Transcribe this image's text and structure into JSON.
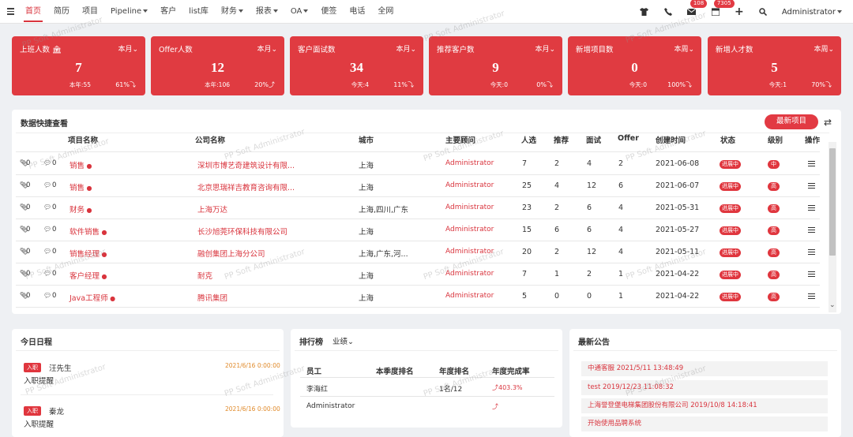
{
  "nav": {
    "items": [
      "首页",
      "简历",
      "项目",
      "Pipeline",
      "客户",
      "list库",
      "财务",
      "报表",
      "OA",
      "便签",
      "电话",
      "全网"
    ],
    "badges": {
      "mail": "108",
      "calendar": "7305"
    },
    "user": "Administrator"
  },
  "cards": [
    {
      "title": "上班人数",
      "period": "本月",
      "value": "7",
      "sub": "本年:55",
      "pct": "61%"
    },
    {
      "title": "Offer人数",
      "period": "本月",
      "value": "12",
      "sub": "本年:106",
      "pct": "20%"
    },
    {
      "title": "客户面试数",
      "period": "本月",
      "value": "34",
      "sub": "今天:4",
      "pct": "11%"
    },
    {
      "title": "推荐客户数",
      "period": "本月",
      "value": "9",
      "sub": "今天:0",
      "pct": "0%"
    },
    {
      "title": "新增项目数",
      "period": "本周",
      "value": "0",
      "sub": "今天:0",
      "pct": "100%"
    },
    {
      "title": "新增人才数",
      "period": "本周",
      "value": "5",
      "sub": "今天:1",
      "pct": "70%"
    }
  ],
  "quick": {
    "title": "数据快捷查看",
    "new_button": "最新项目",
    "headers": [
      "项目名称",
      "公司名称",
      "城市",
      "主要顾问",
      "人选",
      "推荐",
      "面试",
      "Offer",
      "创建时间",
      "状态",
      "级别",
      "操作"
    ],
    "rows": [
      {
        "a": "0",
        "c": "0",
        "project": "销售",
        "company": "深圳市博艺奇建筑设计有限...",
        "city": "上海",
        "advisor": "Administrator",
        "cand": "7",
        "rec": "2",
        "iv": "4",
        "offer": "2",
        "date": "2021-06-08",
        "status": "进展中",
        "level": "中"
      },
      {
        "a": "0",
        "c": "0",
        "project": "销售",
        "company": "北京思瑞祥吉教育咨询有限...",
        "city": "上海",
        "advisor": "Administrator",
        "cand": "25",
        "rec": "4",
        "iv": "12",
        "offer": "6",
        "date": "2021-06-07",
        "status": "进展中",
        "level": "高"
      },
      {
        "a": "0",
        "c": "0",
        "project": "财务",
        "company": "上海万达",
        "city": "上海,四川,广东",
        "advisor": "Administrator",
        "cand": "23",
        "rec": "2",
        "iv": "6",
        "offer": "4",
        "date": "2021-05-31",
        "status": "进展中",
        "level": "高"
      },
      {
        "a": "0",
        "c": "0",
        "project": "软件销售",
        "company": "长沙旭莞环保科技有限公司",
        "city": "上海",
        "advisor": "Administrator",
        "cand": "15",
        "rec": "6",
        "iv": "6",
        "offer": "4",
        "date": "2021-05-27",
        "status": "进展中",
        "level": "高"
      },
      {
        "a": "0",
        "c": "0",
        "project": "销售经理",
        "company": "融创集团上海分公司",
        "city": "上海,广东,河...",
        "advisor": "Administrator",
        "cand": "20",
        "rec": "2",
        "iv": "12",
        "offer": "4",
        "date": "2021-05-11",
        "status": "进展中",
        "level": "高"
      },
      {
        "a": "0",
        "c": "0",
        "project": "客户经理",
        "company": "耐克",
        "city": "上海",
        "advisor": "Administrator",
        "cand": "7",
        "rec": "1",
        "iv": "2",
        "offer": "1",
        "date": "2021-04-22",
        "status": "进展中",
        "level": "高"
      },
      {
        "a": "0",
        "c": "0",
        "project": "Java工程师",
        "company": "腾讯集团",
        "city": "上海",
        "advisor": "Administrator",
        "cand": "5",
        "rec": "0",
        "iv": "0",
        "offer": "1",
        "date": "2021-04-22",
        "status": "进展中",
        "level": "高"
      }
    ]
  },
  "schedule": {
    "title": "今日日程",
    "items": [
      {
        "tag": "入职",
        "name": "汪先生",
        "time": "2021/6/16 0:00:00",
        "desc": "入职提醒"
      },
      {
        "tag": "入职",
        "name": "秦龙",
        "time": "2021/6/16 0:00:00",
        "desc": "入职提醒"
      }
    ]
  },
  "ranking": {
    "title": "排行榜",
    "filter": "业绩",
    "headers": [
      "员工",
      "本季度排名",
      "年度排名",
      "年度完成率"
    ],
    "rows": [
      {
        "name": "李海红",
        "quarter": "",
        "year": "1名/12",
        "rate": "403.3%"
      },
      {
        "name": "Administrator",
        "quarter": "",
        "year": "",
        "rate": ""
      }
    ]
  },
  "notices": {
    "title": "最新公告",
    "items": [
      "中通客服 2021/5/11 13:48:49",
      "test 2019/12/23 11:08:32",
      "上海誉登堡电梯集团股份有限公司 2019/10/8 14:18:41",
      "开始使用品聘系统"
    ]
  },
  "watermark": "PP Soft Administrator"
}
